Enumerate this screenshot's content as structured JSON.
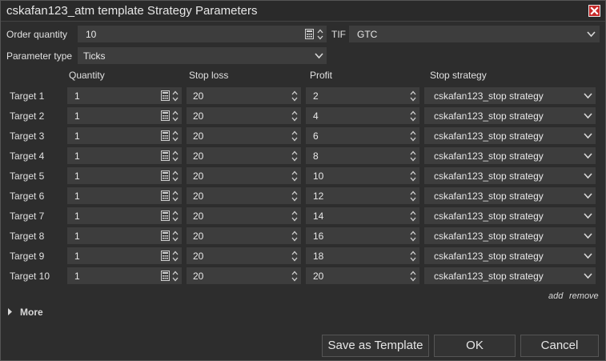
{
  "window": {
    "title": "cskafan123_atm template Strategy Parameters"
  },
  "order": {
    "quantity_label": "Order quantity",
    "quantity_value": "10",
    "tif_label": "TIF",
    "tif_value": "GTC"
  },
  "parameter_type": {
    "label": "Parameter type",
    "value": "Ticks"
  },
  "table": {
    "headers": {
      "quantity": "Quantity",
      "stop_loss": "Stop loss",
      "profit": "Profit",
      "stop_strategy": "Stop strategy"
    },
    "rows": [
      {
        "target": "Target 1",
        "quantity": "1",
        "stop_loss": "20",
        "profit": "2",
        "stop_strategy": "cskafan123_stop strategy"
      },
      {
        "target": "Target 2",
        "quantity": "1",
        "stop_loss": "20",
        "profit": "4",
        "stop_strategy": "cskafan123_stop strategy"
      },
      {
        "target": "Target 3",
        "quantity": "1",
        "stop_loss": "20",
        "profit": "6",
        "stop_strategy": "cskafan123_stop strategy"
      },
      {
        "target": "Target 4",
        "quantity": "1",
        "stop_loss": "20",
        "profit": "8",
        "stop_strategy": "cskafan123_stop strategy"
      },
      {
        "target": "Target 5",
        "quantity": "1",
        "stop_loss": "20",
        "profit": "10",
        "stop_strategy": "cskafan123_stop strategy"
      },
      {
        "target": "Target 6",
        "quantity": "1",
        "stop_loss": "20",
        "profit": "12",
        "stop_strategy": "cskafan123_stop strategy"
      },
      {
        "target": "Target 7",
        "quantity": "1",
        "stop_loss": "20",
        "profit": "14",
        "stop_strategy": "cskafan123_stop strategy"
      },
      {
        "target": "Target 8",
        "quantity": "1",
        "stop_loss": "20",
        "profit": "16",
        "stop_strategy": "cskafan123_stop strategy"
      },
      {
        "target": "Target 9",
        "quantity": "1",
        "stop_loss": "20",
        "profit": "18",
        "stop_strategy": "cskafan123_stop strategy"
      },
      {
        "target": "Target 10",
        "quantity": "1",
        "stop_loss": "20",
        "profit": "20",
        "stop_strategy": "cskafan123_stop strategy"
      }
    ]
  },
  "links": {
    "add": "add",
    "remove": "remove"
  },
  "more": {
    "label": "More"
  },
  "buttons": {
    "save_template": "Save as Template",
    "ok": "OK",
    "cancel": "Cancel"
  },
  "colors": {
    "background": "#2d2d2d",
    "field": "#3d3d3d",
    "close": "#c62828",
    "text": "#e0e0e0"
  },
  "icons": {
    "close": "close-icon",
    "calculator": "calculator-icon",
    "spinner": "spinner-icon",
    "dropdown": "chevron-down-icon",
    "expand": "triangle-right-icon"
  }
}
